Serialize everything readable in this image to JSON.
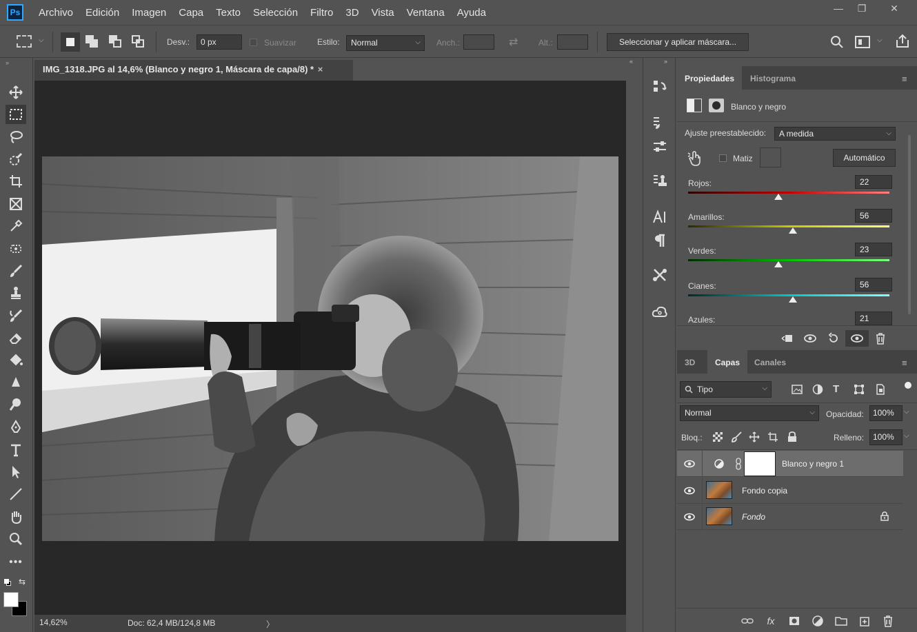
{
  "app": {
    "logo": "Ps"
  },
  "menu": [
    "Archivo",
    "Edición",
    "Imagen",
    "Capa",
    "Texto",
    "Selección",
    "Filtro",
    "3D",
    "Vista",
    "Ventana",
    "Ayuda"
  ],
  "window_controls": {
    "minimize": "—",
    "maximize": "❐",
    "close": "✕"
  },
  "options": {
    "feather_label": "Desv.:",
    "feather_value": "0 px",
    "antialias_label": "Suavizar",
    "style_label": "Estilo:",
    "style_value": "Normal",
    "width_label": "Anch.:",
    "height_label": "Alt.:",
    "mask_button": "Seleccionar y aplicar máscara..."
  },
  "document": {
    "tab_title": "IMG_1318.JPG al 14,6% (Blanco y negro 1, Máscara de capa/8) *",
    "close": "×",
    "zoom": "14,62%",
    "doc_info": "Doc: 62,4 MB/124,8 MB",
    "status_arrow": "〉"
  },
  "properties": {
    "tabs": [
      "Propiedades",
      "Histograma"
    ],
    "adjustment_name": "Blanco y negro",
    "preset_label": "Ajuste preestablecido:",
    "preset_value": "A medida",
    "tint_label": "Matiz",
    "auto_button": "Automático",
    "sliders": [
      {
        "label": "Rojos:",
        "value": "22",
        "fraction": 0.45,
        "gradient": "linear-gradient(90deg,#2a0000,#c00000 50%,#ff8080)"
      },
      {
        "label": "Amarillos:",
        "value": "56",
        "fraction": 0.52,
        "gradient": "linear-gradient(90deg,#2a2a00,#c8c800 50%,#ffff80)"
      },
      {
        "label": "Verdes:",
        "value": "23",
        "fraction": 0.45,
        "gradient": "linear-gradient(90deg,#002a00,#00c000 50%,#80ff80)"
      },
      {
        "label": "Cianes:",
        "value": "56",
        "fraction": 0.52,
        "gradient": "linear-gradient(90deg,#002a2a,#00c8c8 50%,#80ffff)"
      },
      {
        "label": "Azules:",
        "value": "21",
        "fraction": 0.45,
        "gradient": "linear-gradient(90deg,#00002a,#0000c8 50%,#8080ff)"
      }
    ]
  },
  "layers_panel": {
    "tabs": [
      "3D",
      "Capas",
      "Canales"
    ],
    "filter_value": "Tipo",
    "blend_mode": "Normal",
    "opacity_label": "Opacidad:",
    "opacity_value": "100%",
    "lock_label": "Bloq.:",
    "fill_label": "Relleno:",
    "fill_value": "100%",
    "layers": [
      {
        "name": "Blanco y negro 1",
        "selected": true,
        "type": "adjustment"
      },
      {
        "name": "Fondo copia",
        "selected": false,
        "type": "image"
      },
      {
        "name": "Fondo",
        "selected": false,
        "type": "image",
        "locked": true
      }
    ]
  }
}
